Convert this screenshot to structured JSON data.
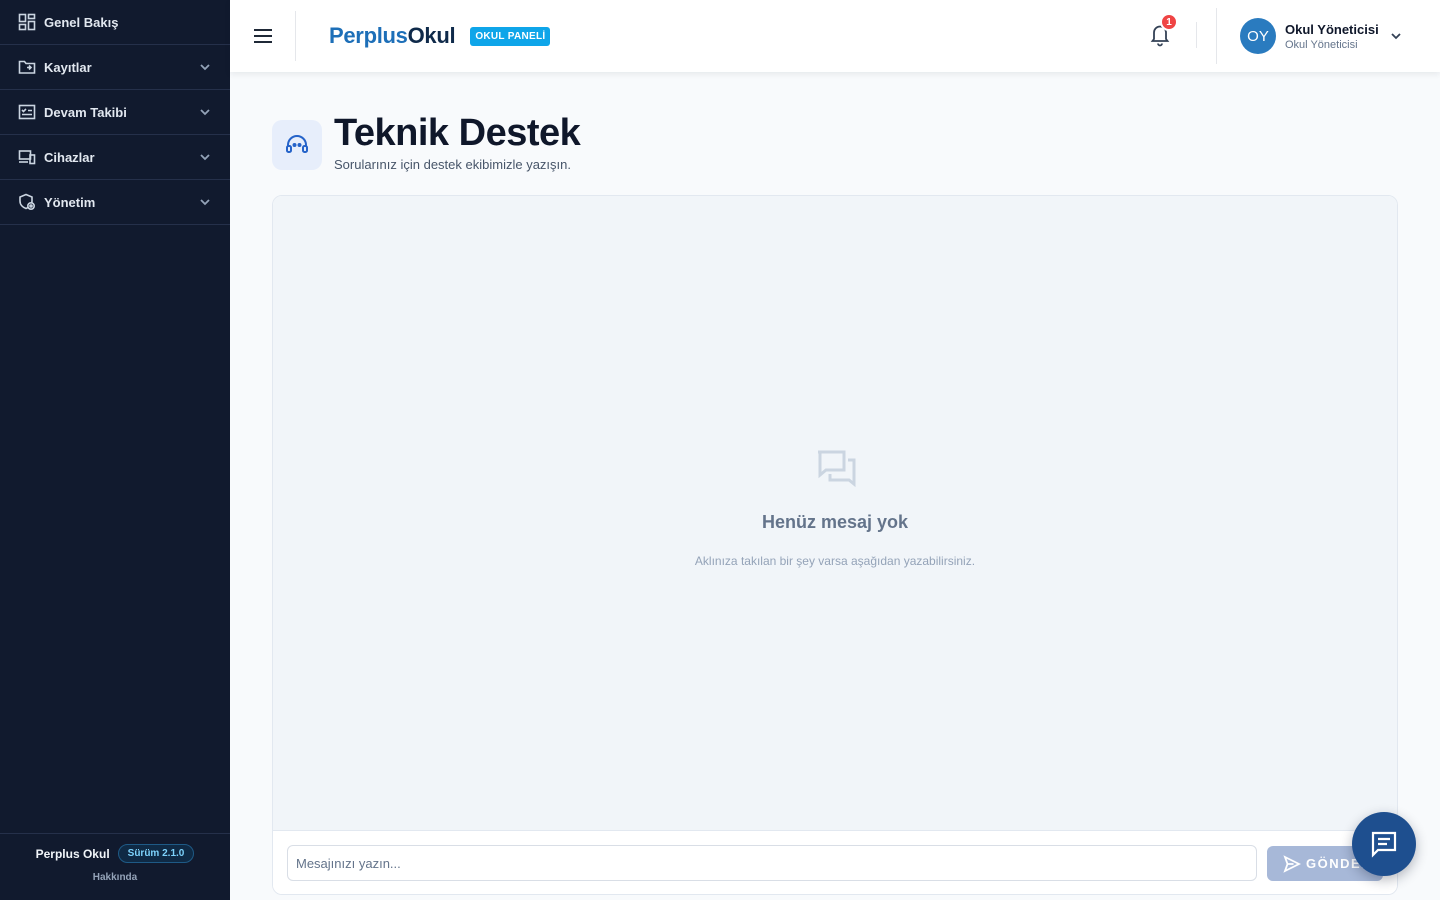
{
  "sidebar": {
    "items": [
      {
        "label": "Genel Bakış",
        "icon": "dashboard-icon",
        "has_chevron": false
      },
      {
        "label": "Kayıtlar",
        "icon": "folder-icon",
        "has_chevron": true
      },
      {
        "label": "Devam Takibi",
        "icon": "attendance-icon",
        "has_chevron": true
      },
      {
        "label": "Cihazlar",
        "icon": "devices-icon",
        "has_chevron": true
      },
      {
        "label": "Yönetim",
        "icon": "admin-shield-icon",
        "has_chevron": true
      }
    ],
    "footer": {
      "app_name": "Perplus Okul",
      "version_badge": "Sürüm 2.1.0",
      "about_link": "Hakkında"
    }
  },
  "topbar": {
    "brand_part1": "Perplus",
    "brand_part2": "Okul",
    "panel_tag": "OKUL PANELİ",
    "notification_count": "1",
    "user": {
      "initials": "OY",
      "name": "Okul Yöneticisi",
      "role": "Okul Yöneticisi"
    }
  },
  "page": {
    "title": "Teknik Destek",
    "subtitle": "Sorularınız için destek ekibimizle yazışın.",
    "icon": "headset-icon"
  },
  "chat": {
    "empty_title": "Henüz mesaj yok",
    "empty_subtitle": "Aklınıza takılan bir şey varsa aşağıdan yazabilirsiniz.",
    "input_placeholder": "Mesajınızı yazın...",
    "input_value": "",
    "send_label": "GÖNDER"
  },
  "colors": {
    "sidebar_bg": "#111a2e",
    "brand_blue": "#1d6fb8",
    "tag_bg": "#0ea5e9",
    "badge_red": "#ef4444",
    "fab_bg": "#1e4f8f",
    "send_disabled": "#a7b8d8"
  }
}
